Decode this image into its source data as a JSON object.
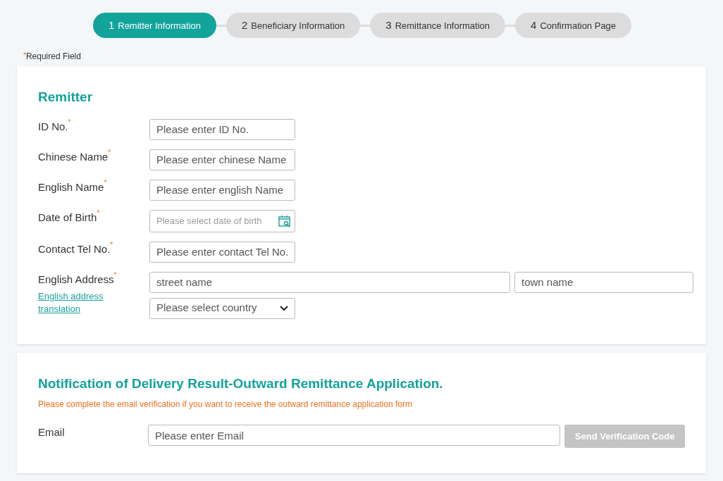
{
  "steps": [
    {
      "number": "1",
      "label": "Remitter Information",
      "selected": true
    },
    {
      "number": "2",
      "label": "Beneficiary Information",
      "selected": false
    },
    {
      "number": "3",
      "label": "Remittance Information",
      "selected": false
    },
    {
      "number": "4",
      "label": "Confirmation Page",
      "selected": false
    }
  ],
  "required_note": {
    "mark": "*",
    "text": "Required Field"
  },
  "remitter": {
    "title": "Remitter",
    "fields": [
      {
        "label": "ID No.",
        "mark": "*",
        "kind": "text",
        "placeholder": "Please enter ID No."
      },
      {
        "label": "Chinese Name",
        "mark": "*",
        "kind": "text",
        "placeholder": "Please enter chinese Name"
      },
      {
        "label": "English Name",
        "mark": "*",
        "kind": "text",
        "placeholder": "Please enter english Name"
      },
      {
        "label": "Date of Birth",
        "mark": "*",
        "kind": "date",
        "placeholder": "Please select date of birth"
      },
      {
        "label": "Contact Tel No.",
        "mark": "*",
        "kind": "text",
        "placeholder": "Please enter contact Tel No."
      },
      {
        "label": "English Address",
        "mark": "*",
        "kind": "address",
        "link": "English address translation",
        "street_placeholder": "street name",
        "town_placeholder": "town name",
        "country_placeholder": "Please select country"
      }
    ]
  },
  "notification": {
    "title": "Notification of Delivery Result-Outward Remittance Application.",
    "note": "Please complete the email verification if you want to receive the outward remittance application form",
    "email_label": "Email",
    "email_placeholder": "Please enter Email",
    "button": "Send Verification Code",
    "button_disabled": true
  }
}
